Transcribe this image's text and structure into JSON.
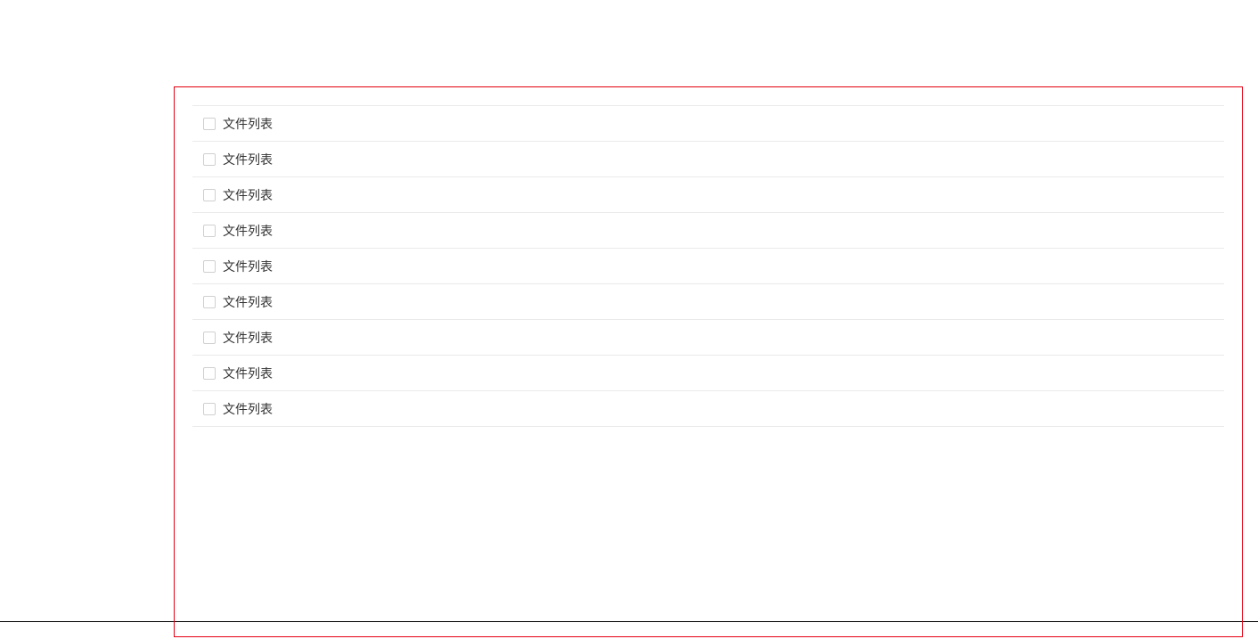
{
  "list": {
    "items": [
      {
        "label": "文件列表"
      },
      {
        "label": "文件列表"
      },
      {
        "label": "文件列表"
      },
      {
        "label": "文件列表"
      },
      {
        "label": "文件列表"
      },
      {
        "label": "文件列表"
      },
      {
        "label": "文件列表"
      },
      {
        "label": "文件列表"
      },
      {
        "label": "文件列表"
      }
    ]
  }
}
